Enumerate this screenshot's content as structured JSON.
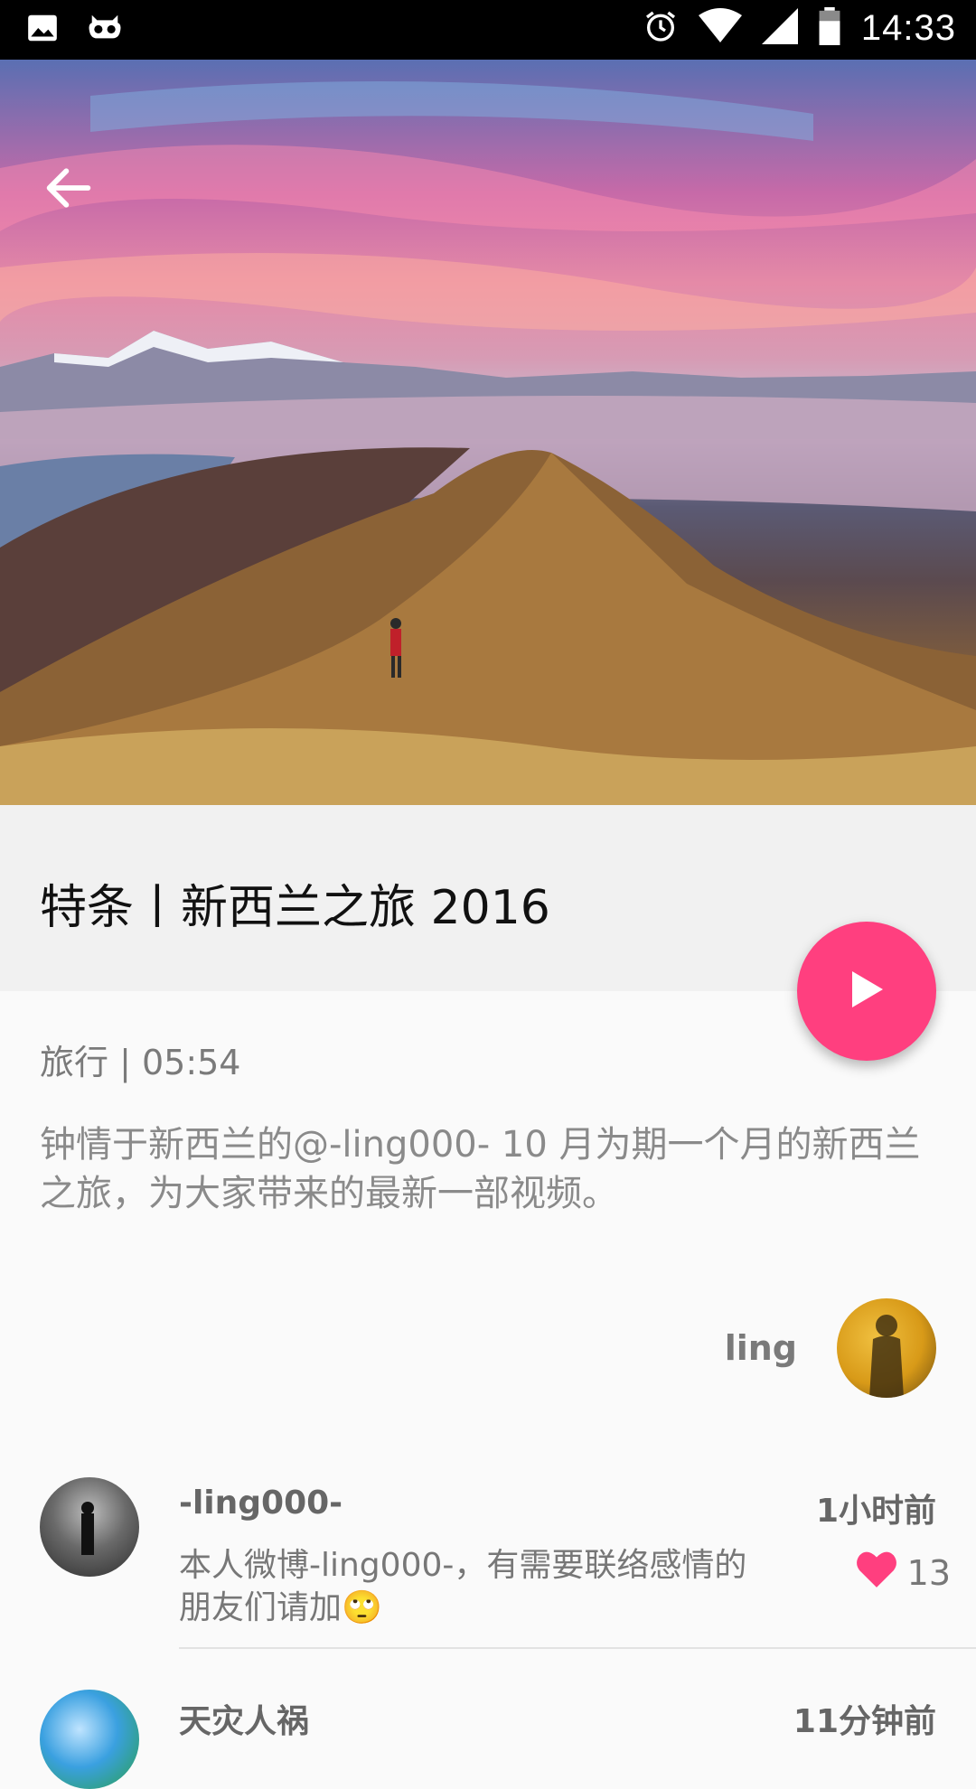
{
  "status_bar": {
    "time": "14:33",
    "left_icons": [
      "image-icon",
      "voicemail-icon"
    ],
    "right_icons": [
      "alarm-icon",
      "wifi-icon",
      "signal-icon",
      "battery-icon"
    ]
  },
  "header": {
    "back_icon": "arrow-left-icon"
  },
  "video": {
    "title": "特条丨新西兰之旅 2016",
    "meta": "旅行 | 05:54",
    "description": "钟情于新西兰的@-ling000- 10 月为期一个月的新西兰之旅，为大家带来的最新一部视频。",
    "author": "ling",
    "play_icon": "play-icon"
  },
  "comments": [
    {
      "name": "-ling000-",
      "time": "1小时前",
      "text": "本人微博-ling000-，有需要联络感情的朋友们请加🙄",
      "likes": "13"
    },
    {
      "name": "天灾人祸",
      "time": "11分钟前",
      "text": "",
      "likes": ""
    }
  ],
  "colors": {
    "accent": "#ff3f7f",
    "status_bar": "#000000",
    "title_band": "#f1f1f1",
    "background": "#fafafa"
  }
}
